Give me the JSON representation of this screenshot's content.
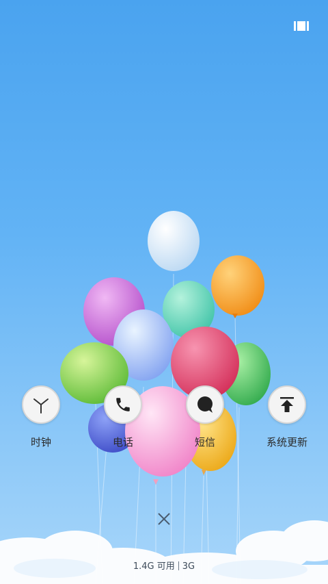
{
  "apps": [
    {
      "label": "时钟",
      "icon": "clock-icon"
    },
    {
      "label": "电话",
      "icon": "phone-icon"
    },
    {
      "label": "短信",
      "icon": "message-icon"
    },
    {
      "label": "系统更新",
      "icon": "system-update-icon"
    }
  ],
  "memory": {
    "available": "1.4G 可用",
    "network": "3G"
  },
  "top_right_icon": "recents-icon",
  "close_icon": "close-icon"
}
